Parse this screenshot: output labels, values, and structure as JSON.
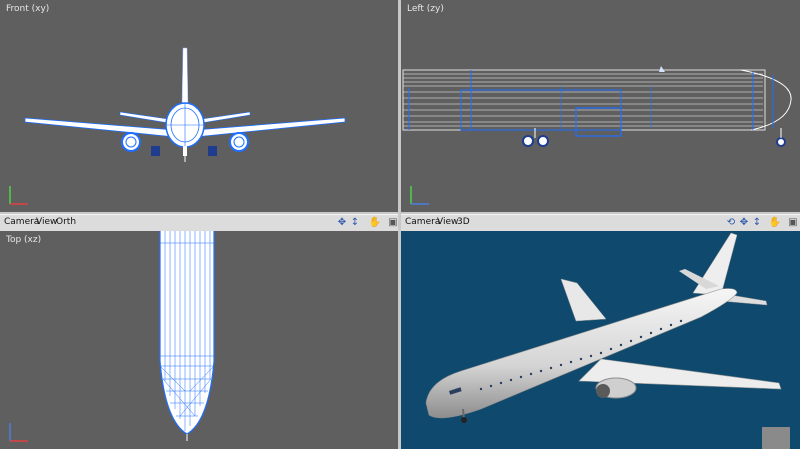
{
  "viewports": {
    "front": {
      "label": "Front (xy)"
    },
    "left": {
      "label": "Left (zy)"
    },
    "top": {
      "label": "Top (xz)"
    },
    "perspective": {
      "label": ""
    }
  },
  "toolbar_left": {
    "camera": "Camera",
    "view": "View",
    "mode": "Orth"
  },
  "toolbar_right": {
    "camera": "Camera",
    "view": "View",
    "mode": "3D"
  },
  "icons": [
    "move-icon",
    "zoom-icon",
    "pan-icon",
    "expand-icon",
    "rotate-icon"
  ],
  "colors": {
    "viewport_grey": "#5f5f5f",
    "viewport_blue": "#0f4a6e",
    "wireframe": "#1e6fff",
    "toolbar": "#dcdcdc"
  }
}
